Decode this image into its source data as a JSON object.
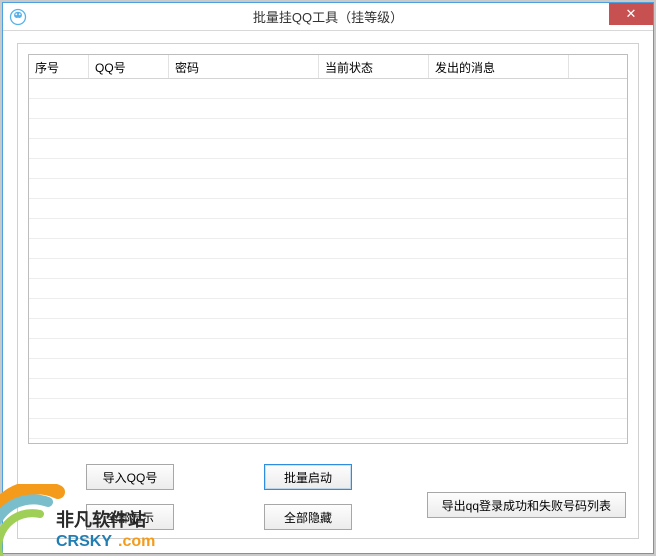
{
  "window": {
    "title": "批量挂QQ工具（挂等级）"
  },
  "columns": {
    "seq": "序号",
    "qq": "QQ号",
    "pwd": "密码",
    "status": "当前状态",
    "msg": "发出的消息"
  },
  "buttons": {
    "import": "导入QQ号",
    "start": "批量启动",
    "showall": "全部显示",
    "hideall": "全部隐藏",
    "export": "导出qq登录成功和失败号码列表"
  },
  "close_label": "✕",
  "brand": {
    "line1": "非凡软件站",
    "line2": "CRSKY.com"
  },
  "colors": {
    "border": "#4aa0e0",
    "close_bg": "#c75050"
  }
}
